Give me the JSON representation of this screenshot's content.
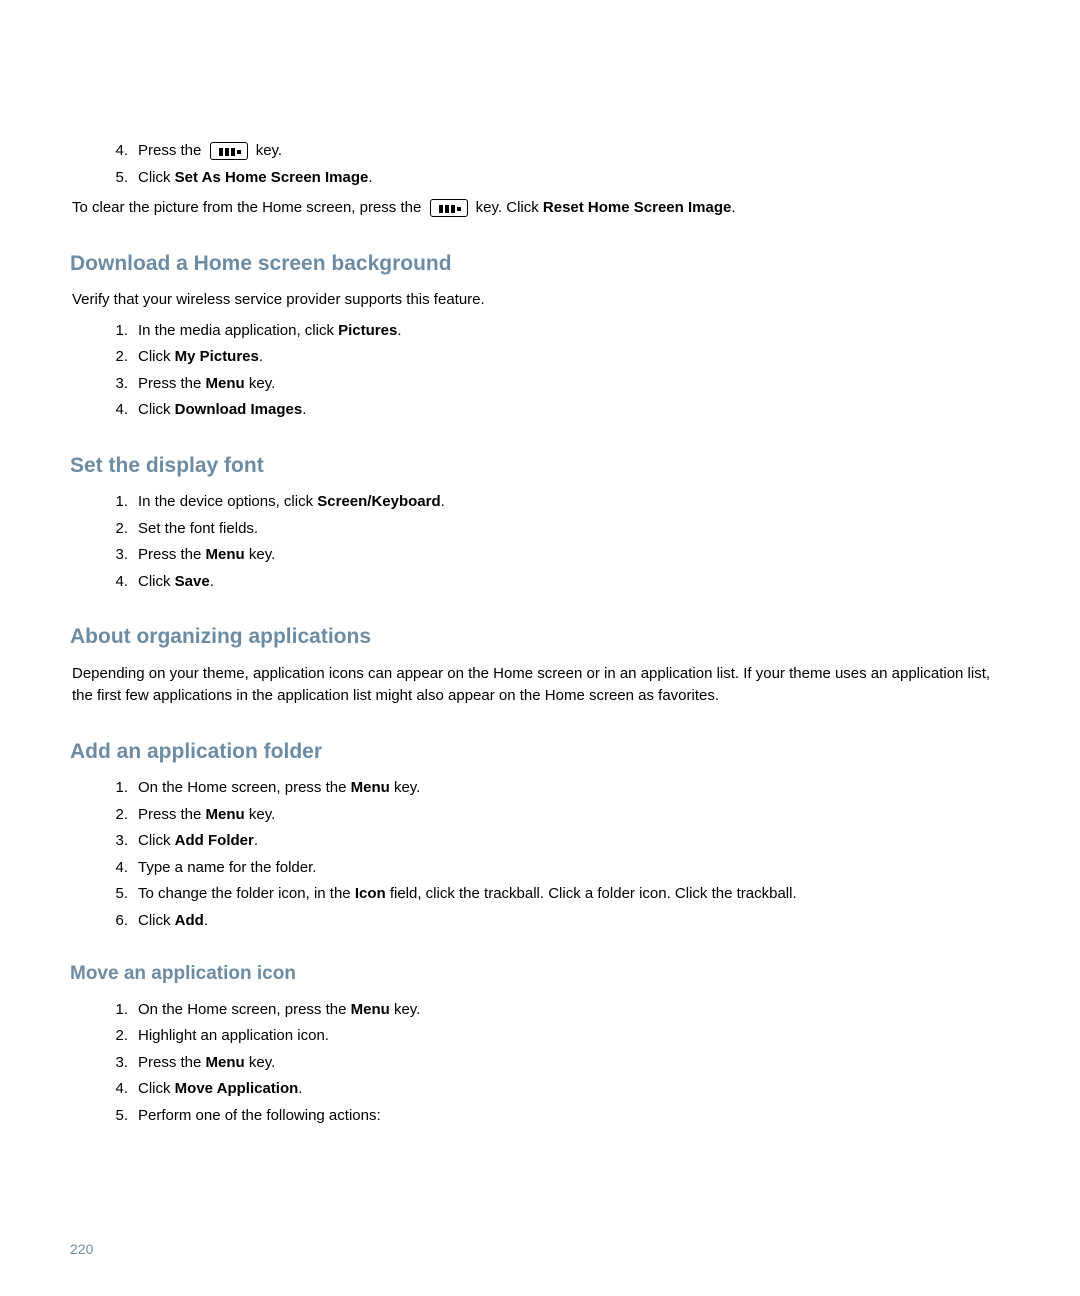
{
  "top_list": {
    "item4": {
      "num": "4.",
      "text_before": "Press the ",
      "text_after": " key."
    },
    "item5": {
      "num": "5.",
      "text": "Click ",
      "bold": "Set As Home Screen Image",
      "suffix": "."
    }
  },
  "top_paragraph": {
    "part1": "To clear the picture from the Home screen, press the ",
    "part2": " key. Click ",
    "bold": "Reset Home Screen Image",
    "suffix": "."
  },
  "sections": {
    "download": {
      "heading": "Download a Home screen background",
      "intro": "Verify that your wireless service provider supports this feature.",
      "items": [
        {
          "num": "1.",
          "parts": [
            {
              "t": "In the media application, click "
            },
            {
              "b": "Pictures"
            },
            {
              "t": "."
            }
          ]
        },
        {
          "num": "2.",
          "parts": [
            {
              "t": "Click "
            },
            {
              "b": "My Pictures"
            },
            {
              "t": "."
            }
          ]
        },
        {
          "num": "3.",
          "parts": [
            {
              "t": "Press the "
            },
            {
              "b": "Menu"
            },
            {
              "t": " key."
            }
          ]
        },
        {
          "num": "4.",
          "parts": [
            {
              "t": "Click "
            },
            {
              "b": "Download Images"
            },
            {
              "t": "."
            }
          ]
        }
      ]
    },
    "font": {
      "heading": "Set the display font",
      "items": [
        {
          "num": "1.",
          "parts": [
            {
              "t": "In the device options, click "
            },
            {
              "b": "Screen/Keyboard"
            },
            {
              "t": "."
            }
          ]
        },
        {
          "num": "2.",
          "parts": [
            {
              "t": "Set the font fields."
            }
          ]
        },
        {
          "num": "3.",
          "parts": [
            {
              "t": "Press the "
            },
            {
              "b": "Menu"
            },
            {
              "t": " key."
            }
          ]
        },
        {
          "num": "4.",
          "parts": [
            {
              "t": "Click "
            },
            {
              "b": "Save"
            },
            {
              "t": "."
            }
          ]
        }
      ]
    },
    "organizing": {
      "heading": "About organizing applications",
      "body": "Depending on your theme, application icons can appear on the Home screen or in an application list. If your theme uses an application list, the first few applications in the application list might also appear on the Home screen as favorites."
    },
    "folder": {
      "heading": "Add an application folder",
      "items": [
        {
          "num": "1.",
          "parts": [
            {
              "t": "On the Home screen, press the "
            },
            {
              "b": "Menu"
            },
            {
              "t": " key."
            }
          ]
        },
        {
          "num": "2.",
          "parts": [
            {
              "t": "Press the "
            },
            {
              "b": "Menu"
            },
            {
              "t": " key."
            }
          ]
        },
        {
          "num": "3.",
          "parts": [
            {
              "t": "Click "
            },
            {
              "b": "Add Folder"
            },
            {
              "t": "."
            }
          ]
        },
        {
          "num": "4.",
          "parts": [
            {
              "t": "Type a name for the folder."
            }
          ]
        },
        {
          "num": "5.",
          "parts": [
            {
              "t": "To change the folder icon, in the "
            },
            {
              "b": "Icon"
            },
            {
              "t": " field, click the trackball. Click a folder icon. Click the trackball."
            }
          ]
        },
        {
          "num": "6.",
          "parts": [
            {
              "t": "Click "
            },
            {
              "b": "Add"
            },
            {
              "t": "."
            }
          ]
        }
      ]
    },
    "move": {
      "heading": "Move an application icon",
      "items": [
        {
          "num": "1.",
          "parts": [
            {
              "t": "On the Home screen, press the "
            },
            {
              "b": "Menu"
            },
            {
              "t": " key."
            }
          ]
        },
        {
          "num": "2.",
          "parts": [
            {
              "t": "Highlight an application icon."
            }
          ]
        },
        {
          "num": "3.",
          "parts": [
            {
              "t": "Press the "
            },
            {
              "b": "Menu"
            },
            {
              "t": " key."
            }
          ]
        },
        {
          "num": "4.",
          "parts": [
            {
              "t": "Click "
            },
            {
              "b": "Move Application"
            },
            {
              "t": "."
            }
          ]
        },
        {
          "num": "5.",
          "parts": [
            {
              "t": "Perform one of the following actions:"
            }
          ]
        }
      ]
    }
  },
  "page_number": "220"
}
